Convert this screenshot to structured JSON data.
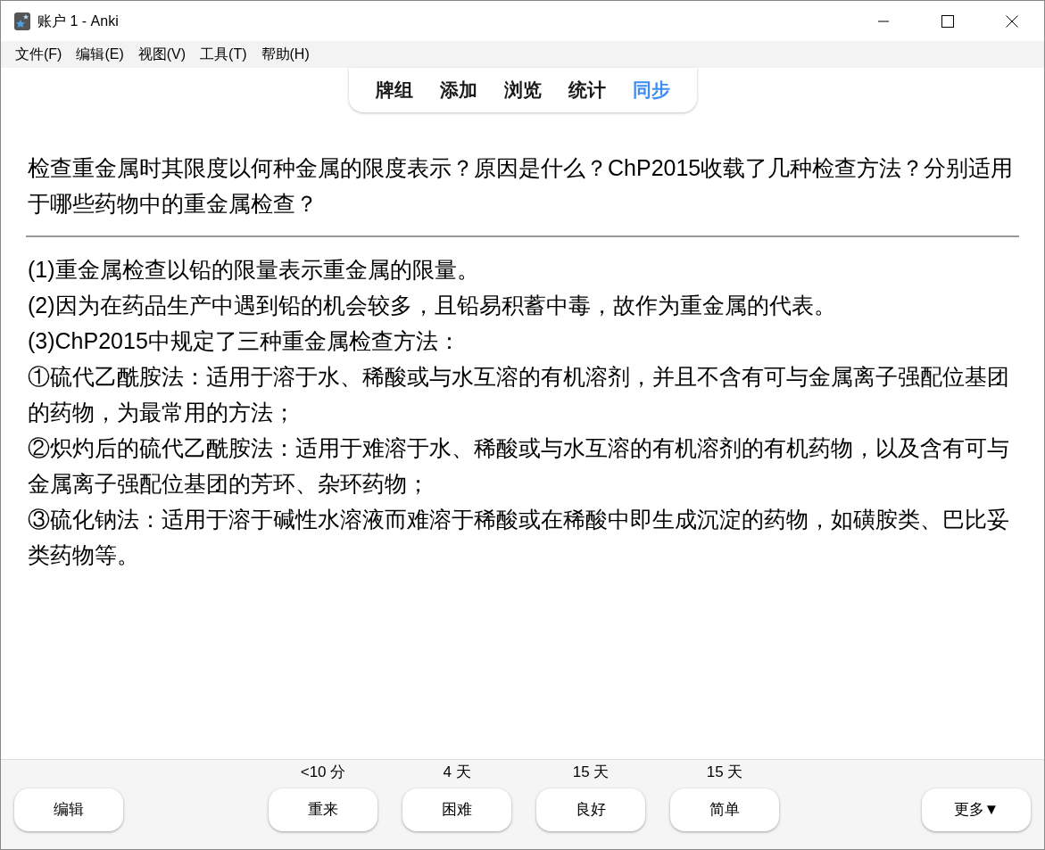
{
  "window": {
    "title": "账户 1 - Anki"
  },
  "menu": [
    "文件(F)",
    "编辑(E)",
    "视图(V)",
    "工具(T)",
    "帮助(H)"
  ],
  "toolbar": [
    {
      "label": "牌组",
      "attention": false
    },
    {
      "label": "添加",
      "attention": false
    },
    {
      "label": "浏览",
      "attention": false
    },
    {
      "label": "统计",
      "attention": false
    },
    {
      "label": "同步",
      "attention": true
    }
  ],
  "question": "检查重金属时其限度以何种金属的限度表示？原因是什么？ChP2015收载了几种检查方法？分别适用于哪些药物中的重金属检查？",
  "answer": [
    "(1)重金属检查以铅的限量表示重金属的限量。",
    "(2)因为在药品生产中遇到铅的机会较多，且铅易积蓄中毒，故作为重金属的代表。",
    "(3)ChP2015中规定了三种重金属检查方法：",
    "①硫代乙酰胺法：适用于溶于水、稀酸或与水互溶的有机溶剂，并且不含有可与金属离子强配位基团的药物，为最常用的方法；",
    "②炽灼后的硫代乙酰胺法：适用于难溶于水、稀酸或与水互溶的有机溶剂的有机药物，以及含有可与金属离子强配位基团的芳环、杂环药物；",
    "③硫化钠法：适用于溶于碱性水溶液而难溶于稀酸或在稀酸中即生成沉淀的药物，如磺胺类、巴比妥类药物等。"
  ],
  "bottom_bar": {
    "edit_button": "编辑",
    "answer_buttons": [
      {
        "interval": "<10 分",
        "label": "重来"
      },
      {
        "interval": "4 天",
        "label": "困难"
      },
      {
        "interval": "15 天",
        "label": "良好"
      },
      {
        "interval": "15 天",
        "label": "简单"
      }
    ],
    "more_button": "更多▼"
  }
}
